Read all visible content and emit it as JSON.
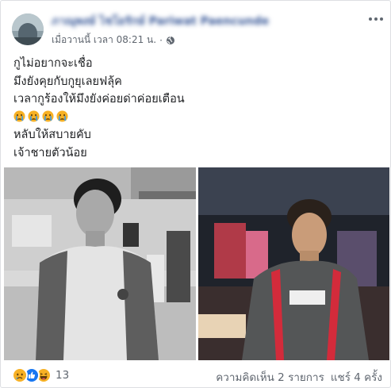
{
  "post": {
    "author_name": "ภาณุพงษ์ ไชโยรักษ์ Pariwat Paencunde",
    "timestamp": "เมื่อวานนี้ เวลา 08:21 น.",
    "separator": "·",
    "privacy_icon": "globe-icon",
    "more_icon": "more-icon",
    "lines": [
      "กูไม่อยากจะเชื่อ",
      "มึงยังคุยกับกูยุเลยฟลุ้ค",
      "เวลากูร้องให้มึงยังค่อยด่าค่อยเตือน",
      "",
      "หลับให้สบายคับ",
      "เจ้าชายตัวน้อย"
    ],
    "emoji_line": [
      "crying-face-icon",
      "crying-face-icon",
      "crying-face-icon",
      "crying-face-icon"
    ]
  },
  "photos": [
    {
      "name": "photo-left",
      "style": "black-and-white"
    },
    {
      "name": "photo-right",
      "style": "color"
    }
  ],
  "footer": {
    "reaction_icons": [
      "sad-reaction-icon",
      "like-reaction-icon",
      "haha-reaction-icon"
    ],
    "reaction_count": "13",
    "comments": "ความคิดเห็น 2 รายการ",
    "shares": "แชร์ 4 ครั้ง"
  },
  "colors": {
    "link": "#385898",
    "secondary_text": "#606770",
    "like": "#1877f2",
    "sad": "#f7b125"
  }
}
